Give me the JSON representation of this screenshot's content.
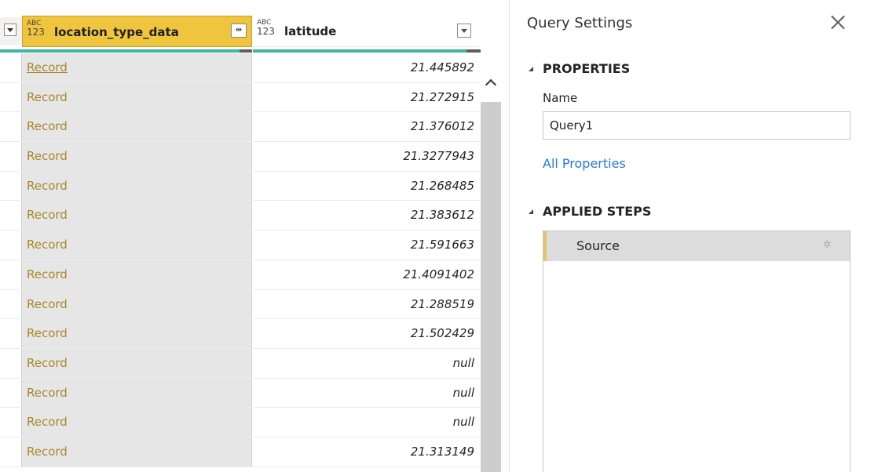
{
  "grid": {
    "columns": [
      {
        "name": "location_type_data",
        "type_top": "ABC",
        "type_bottom": "123"
      },
      {
        "name": "latitude",
        "type_top": "ABC",
        "type_bottom": "123"
      }
    ],
    "expand_icon": "expand-columns-icon",
    "rows": [
      {
        "location_type_data": "Record",
        "latitude": "21.445892"
      },
      {
        "location_type_data": "Record",
        "latitude": "21.272915"
      },
      {
        "location_type_data": "Record",
        "latitude": "21.376012"
      },
      {
        "location_type_data": "Record",
        "latitude": "21.3277943"
      },
      {
        "location_type_data": "Record",
        "latitude": "21.268485"
      },
      {
        "location_type_data": "Record",
        "latitude": "21.383612"
      },
      {
        "location_type_data": "Record",
        "latitude": "21.591663"
      },
      {
        "location_type_data": "Record",
        "latitude": "21.4091402"
      },
      {
        "location_type_data": "Record",
        "latitude": "21.288519"
      },
      {
        "location_type_data": "Record",
        "latitude": "21.502429"
      },
      {
        "location_type_data": "Record",
        "latitude": "null"
      },
      {
        "location_type_data": "Record",
        "latitude": "null"
      },
      {
        "location_type_data": "Record",
        "latitude": "null"
      },
      {
        "location_type_data": "Record",
        "latitude": "21.313149"
      }
    ]
  },
  "query_settings": {
    "title": "Query Settings",
    "properties": {
      "heading": "PROPERTIES",
      "name_label": "Name",
      "name_value": "Query1",
      "all_properties_link": "All Properties"
    },
    "applied_steps": {
      "heading": "APPLIED STEPS",
      "steps": [
        "Source"
      ]
    }
  },
  "colors": {
    "selected_column_header": "#efc53f",
    "record_link": "#a8872b",
    "column_quality": "#3fb7a0",
    "link_blue": "#2b79d0"
  }
}
